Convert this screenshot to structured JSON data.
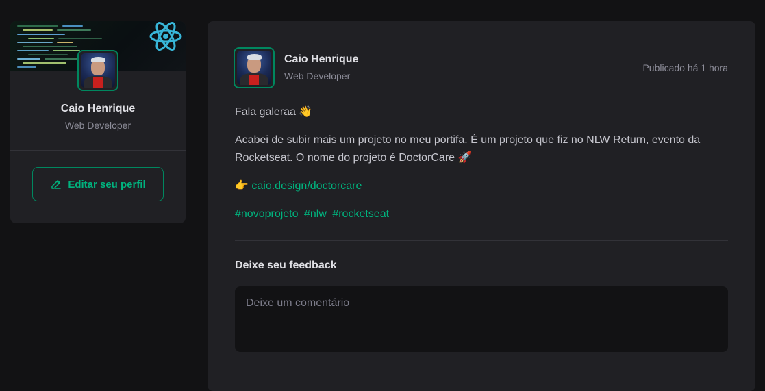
{
  "sidebar": {
    "profile_name": "Caio Henrique",
    "profile_role": "Web Developer",
    "edit_button_label": "Editar seu perfil",
    "edit_icon": "pencil-line-icon",
    "cover_logo_icon": "react-atom-icon"
  },
  "post": {
    "author_name": "Caio Henrique",
    "author_role": "Web Developer",
    "published_label": "Publicado há 1 hora",
    "greeting": "Fala galeraa 👋",
    "body": "Acabei de subir mais um projeto no meu portifa. É um projeto que fiz no NLW Return, evento da Rocketseat. O nome do projeto é DoctorCare 🚀",
    "link_prefix": "👉",
    "link_text": "caio.design/doctorcare",
    "hashtags": [
      "#novoprojeto",
      "#nlw",
      "#rocketseat"
    ]
  },
  "feedback": {
    "title": "Deixe seu feedback",
    "placeholder": "Deixe um comentário",
    "value": ""
  },
  "colors": {
    "background": "#121214",
    "card": "#202024",
    "accent": "#00b37e",
    "accent_border": "#00875f",
    "text_muted": "#8d8d99"
  }
}
